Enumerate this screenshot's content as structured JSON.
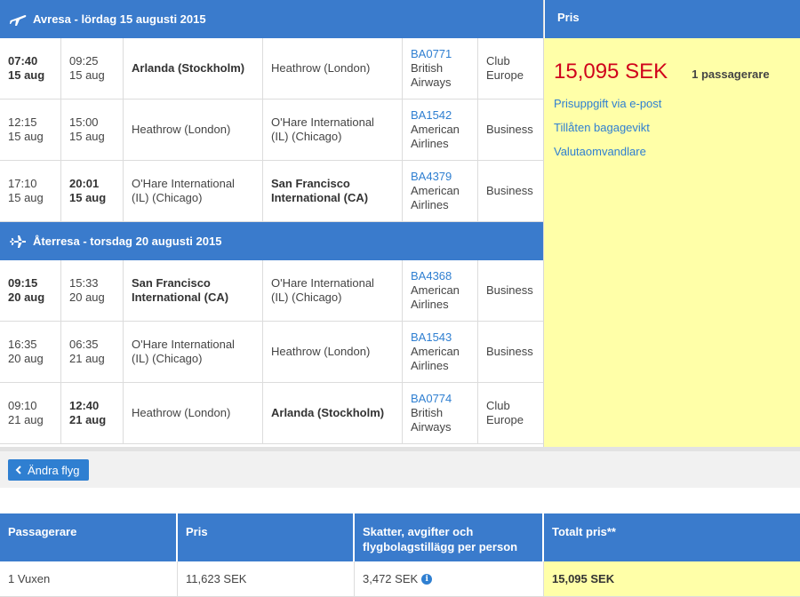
{
  "outbound": {
    "title": "Avresa - lördag 15 augusti 2015",
    "rows": [
      {
        "dep_time": "07:40",
        "dep_date": "15 aug",
        "dep_bold": true,
        "arr_time": "09:25",
        "arr_date": "15 aug",
        "arr_bold": false,
        "from": "Arlanda (Stockholm)",
        "from_bold": true,
        "to": "Heathrow (London)",
        "to_bold": false,
        "flight_no": "BA0771",
        "airline": "British Airways",
        "cabin": "Club Europe"
      },
      {
        "dep_time": "12:15",
        "dep_date": "15 aug",
        "dep_bold": false,
        "arr_time": "15:00",
        "arr_date": "15 aug",
        "arr_bold": false,
        "from": "Heathrow (London)",
        "from_bold": false,
        "to": "O'Hare International (IL) (Chicago)",
        "to_bold": false,
        "flight_no": "BA1542",
        "airline": "American Airlines",
        "cabin": "Business"
      },
      {
        "dep_time": "17:10",
        "dep_date": "15 aug",
        "dep_bold": false,
        "arr_time": "20:01",
        "arr_date": "15 aug",
        "arr_bold": true,
        "from": "O'Hare International (IL) (Chicago)",
        "from_bold": false,
        "to": "San Francisco International (CA)",
        "to_bold": true,
        "flight_no": "BA4379",
        "airline": "American Airlines",
        "cabin": "Business"
      }
    ]
  },
  "return": {
    "title": "Återresa - torsdag 20 augusti 2015",
    "rows": [
      {
        "dep_time": "09:15",
        "dep_date": "20 aug",
        "dep_bold": true,
        "arr_time": "15:33",
        "arr_date": "20 aug",
        "arr_bold": false,
        "from": "San Francisco International (CA)",
        "from_bold": true,
        "to": "O'Hare International (IL) (Chicago)",
        "to_bold": false,
        "flight_no": "BA4368",
        "airline": "American Airlines",
        "cabin": "Business"
      },
      {
        "dep_time": "16:35",
        "dep_date": "20 aug",
        "dep_bold": false,
        "arr_time": "06:35",
        "arr_date": "21 aug",
        "arr_bold": false,
        "from": "O'Hare International (IL) (Chicago)",
        "from_bold": false,
        "to": "Heathrow (London)",
        "to_bold": false,
        "flight_no": "BA1543",
        "airline": "American Airlines",
        "cabin": "Business"
      },
      {
        "dep_time": "09:10",
        "dep_date": "21 aug",
        "dep_bold": false,
        "arr_time": "12:40",
        "arr_date": "21 aug",
        "arr_bold": true,
        "from": "Heathrow (London)",
        "from_bold": false,
        "to": "Arlanda (Stockholm)",
        "to_bold": true,
        "flight_no": "BA0774",
        "airline": "British Airways",
        "cabin": "Club Europe"
      }
    ]
  },
  "price_panel": {
    "header": "Pris",
    "amount": "15,095 SEK",
    "passengers": "1 passagerare",
    "links": [
      "Prisuppgift via e-post",
      "Tillåten bagagevikt",
      "Valutaomvandlare"
    ]
  },
  "change_button": {
    "label": "Ändra flyg"
  },
  "summary": {
    "headers": [
      "Passagerare",
      "Pris",
      "Skatter, avgifter och flygbolagstillägg per person",
      "Totalt pris**"
    ],
    "row": {
      "passenger": "1 Vuxen",
      "price": "11,623 SEK",
      "taxes": "3,472 SEK",
      "total": "15,095 SEK"
    }
  },
  "colors": {
    "header_blue": "#3a7bcc",
    "link_blue": "#2f7fd1",
    "price_red": "#d0021b",
    "panel_yellow": "#ffffa8"
  },
  "icons": {
    "outbound": "plane-departure-icon",
    "return": "plane-return-icon",
    "back": "chevron-left-icon",
    "info": "info-icon"
  }
}
